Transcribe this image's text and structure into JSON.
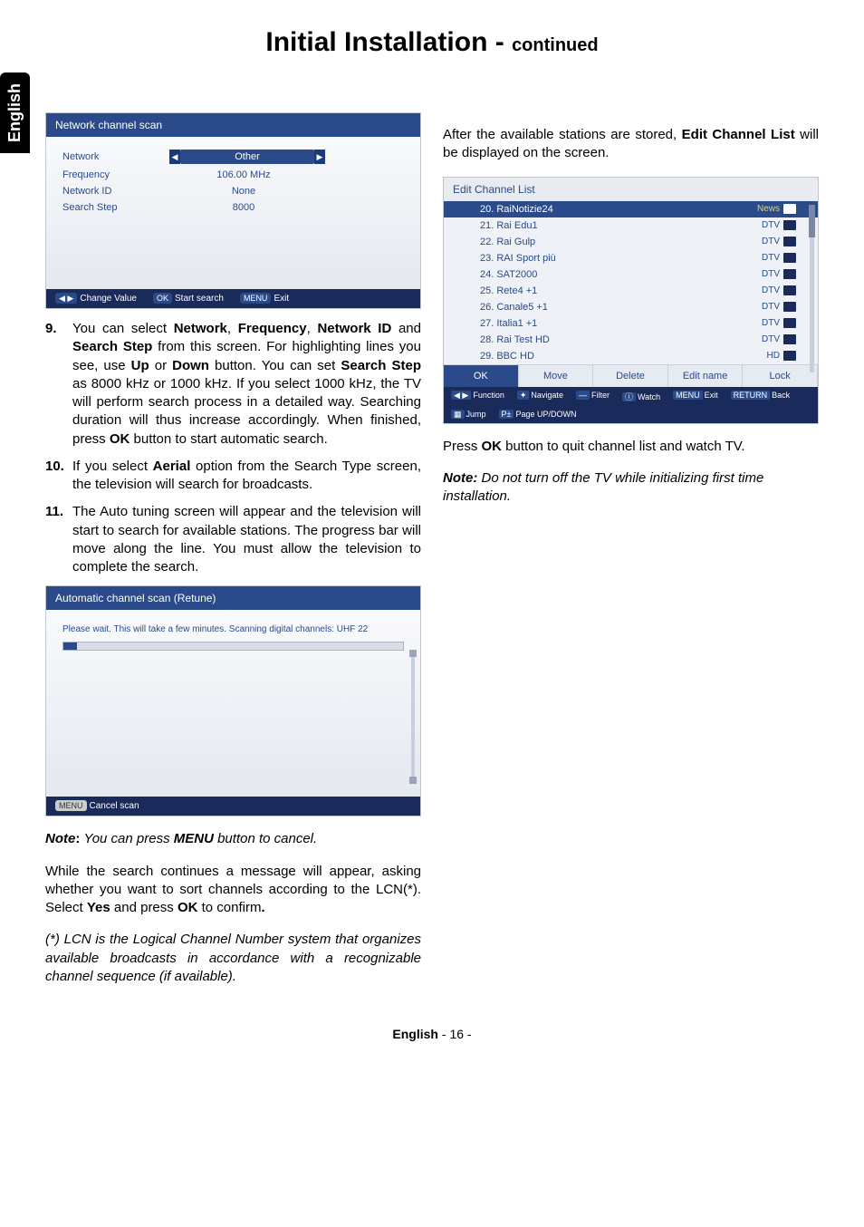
{
  "side_tab": "English",
  "title_main": "Initial Installation - ",
  "title_cont": "continued",
  "network_scan": {
    "title": "Network channel scan",
    "rows": [
      {
        "label": "Network",
        "value": "Other",
        "highlight": true
      },
      {
        "label": "Frequency",
        "value": "106.00 MHz",
        "highlight": false
      },
      {
        "label": "Network ID",
        "value": "None",
        "highlight": false
      },
      {
        "label": "Search Step",
        "value": "8000",
        "highlight": false
      }
    ],
    "footer": [
      {
        "badge": "◀ ▶",
        "text": "Change Value"
      },
      {
        "badge": "OK",
        "text": "Start search"
      },
      {
        "badge": "MENU",
        "text": "Exit"
      }
    ]
  },
  "steps": {
    "s9": {
      "num": "9.",
      "text_a": "You can select ",
      "b1": "Network",
      "text_b": ", ",
      "b2": "Frequency",
      "text_c": ", ",
      "b3": "Network ID",
      "text_d": " and ",
      "b4": "Search Step",
      "text_e": " from this screen. For highlighting lines you see, use ",
      "b5": "Up",
      "text_f": " or ",
      "b6": "Down",
      "text_g": " button. You can set ",
      "b7": "Search Step",
      "text_h": " as 8000 kHz or 1000 kHz. If you select 1000 kHz, the TV will perform search process in a detailed way. Searching duration will thus increase accordingly. When finished, press ",
      "b8": "OK",
      "text_i": " button to start automatic search."
    },
    "s10": {
      "num": "10.",
      "text_a": "If you select ",
      "b1": "Aerial",
      "text_b": " option from the Search Type screen, the television will search for broadcasts."
    },
    "s11": {
      "num": "11.",
      "text": "The Auto tuning screen will appear and the television will start to search for available stations. The progress bar will move along the line. You must allow the television to complete the search."
    }
  },
  "auto_scan": {
    "title": "Automatic channel scan (Retune)",
    "msg": "Please wait. This will take a few minutes. Scanning digital channels: UHF 22",
    "footer_badge": "MENU",
    "footer_text": "Cancel scan"
  },
  "left_tail": {
    "note_label": "Note",
    "note_body": ": ",
    "note_text": "You can press ",
    "note_b": "MENU",
    "note_text2": " button to cancel.",
    "p2_a": "While the search continues a message will appear, asking whether you want to sort channels according to the LCN(*). Select ",
    "p2_b1": "Yes",
    "p2_b": " and press ",
    "p2_b2": "OK",
    "p2_c": " to confirm",
    "p2_dot": ".",
    "p3": "(*) LCN is the Logical Channel Number system that organizes available broadcasts in accordance with a recognizable channel sequence (if available)."
  },
  "right": {
    "intro_a": "After the available stations are stored, ",
    "intro_b": "Edit Channel List",
    "intro_c": " will be displayed on the screen.",
    "press_a": "Press ",
    "press_b": "OK",
    "press_c": " button to quit channel list and watch TV.",
    "note_label": "Note:",
    "note_text": " Do not turn off the TV while initializing first time installation."
  },
  "channel_list": {
    "title": "Edit Channel List",
    "rows": [
      {
        "name": "20. RaiNotizie24",
        "tag": "News",
        "hi": true
      },
      {
        "name": "21. Rai Edu1",
        "tag": "DTV",
        "hi": false
      },
      {
        "name": "22. Rai Gulp",
        "tag": "DTV",
        "hi": false
      },
      {
        "name": "23. RAI Sport più",
        "tag": "DTV",
        "hi": false
      },
      {
        "name": "24. SAT2000",
        "tag": "DTV",
        "hi": false
      },
      {
        "name": "25. Rete4 +1",
        "tag": "DTV",
        "hi": false
      },
      {
        "name": "26. Canale5 +1",
        "tag": "DTV",
        "hi": false
      },
      {
        "name": "27. Italia1 +1",
        "tag": "DTV",
        "hi": false
      },
      {
        "name": "28. Rai Test HD",
        "tag": "DTV",
        "hi": false
      },
      {
        "name": "29. BBC HD",
        "tag": "HD",
        "hi": false
      }
    ],
    "actions": [
      "OK",
      "Move",
      "Delete",
      "Edit name",
      "Lock"
    ],
    "legend": [
      {
        "b": "◀ ▶",
        "t": "Function"
      },
      {
        "b": "✦",
        "t": "Navigate"
      },
      {
        "b": "—",
        "t": "Filter"
      },
      {
        "b": "ⓘ",
        "t": "Watch"
      },
      {
        "b": "MENU",
        "t": "Exit"
      },
      {
        "b": "RETURN",
        "t": "Back"
      },
      {
        "b": "▦",
        "t": "Jump"
      },
      {
        "b": "P±",
        "t": "Page UP/DOWN"
      }
    ]
  },
  "footer": {
    "lang": "English",
    "sep": "   - ",
    "page": "16",
    "end": " -"
  }
}
